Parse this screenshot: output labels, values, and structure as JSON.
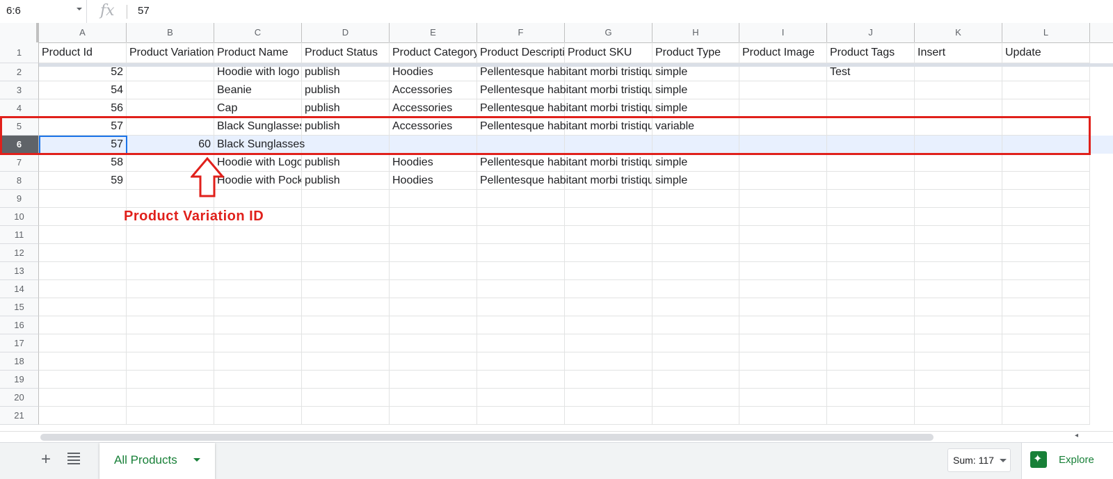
{
  "formula_bar": {
    "name_box": "6:6",
    "fx": "fx",
    "value": "57"
  },
  "columns": [
    "A",
    "B",
    "C",
    "D",
    "E",
    "F",
    "G",
    "H",
    "I",
    "J",
    "K",
    "L"
  ],
  "row_numbers": [
    "1",
    "2",
    "3",
    "4",
    "5",
    "6",
    "7",
    "8",
    "9",
    "10",
    "11",
    "12",
    "13",
    "14",
    "15",
    "16",
    "17",
    "18",
    "19",
    "20",
    "21"
  ],
  "headers": [
    "Product Id",
    "Product Variation",
    "Product Name",
    "Product Status",
    "Product Category",
    "Product Description",
    "Product SKU",
    "Product Type",
    "Product Image",
    "Product Tags",
    "Insert",
    "Update"
  ],
  "rows": [
    {
      "id": "52",
      "var": "",
      "name": "Hoodie with logo",
      "status": "publish",
      "cat": "Hoodies",
      "desc": "Pellentesque habitant morbi tristique",
      "sku": "",
      "type": "simple",
      "image": "",
      "tags": "Test"
    },
    {
      "id": "54",
      "var": "",
      "name": "Beanie",
      "status": "publish",
      "cat": "Accessories",
      "desc": "Pellentesque habitant morbi tristique",
      "sku": "",
      "type": "simple",
      "image": "",
      "tags": ""
    },
    {
      "id": "56",
      "var": "",
      "name": "Cap",
      "status": "publish",
      "cat": "Accessories",
      "desc": "Pellentesque habitant morbi tristique",
      "sku": "",
      "type": "simple",
      "image": "",
      "tags": ""
    },
    {
      "id": "57",
      "var": "",
      "name": "Black Sunglasses",
      "status": "publish",
      "cat": "Accessories",
      "desc": "Pellentesque habitant morbi tristique",
      "sku": "",
      "type": "variable",
      "image": "",
      "tags": ""
    },
    {
      "id": "57",
      "var": "60",
      "name": "Black Sunglasses",
      "status": "",
      "cat": "",
      "desc": "",
      "sku": "",
      "type": "",
      "image": "",
      "tags": ""
    },
    {
      "id": "58",
      "var": "",
      "name": "Hoodie with Logo",
      "status": "publish",
      "cat": "Hoodies",
      "desc": "Pellentesque habitant morbi tristique",
      "sku": "",
      "type": "simple",
      "image": "",
      "tags": ""
    },
    {
      "id": "59",
      "var": "",
      "name": "Hoodie with Pocket",
      "status": "publish",
      "cat": "Hoodies",
      "desc": "Pellentesque habitant morbi tristique",
      "sku": "",
      "type": "simple",
      "image": "",
      "tags": ""
    }
  ],
  "annotation": {
    "label": "Product Variation ID",
    "color": "#e0201b"
  },
  "sheet_bar": {
    "active_tab": "All Products",
    "sum": "Sum: 117",
    "explore": "Explore"
  },
  "colors": {
    "accent_green": "#188038",
    "selection_blue": "#1a73e8",
    "highlight_red": "#e0201b"
  }
}
